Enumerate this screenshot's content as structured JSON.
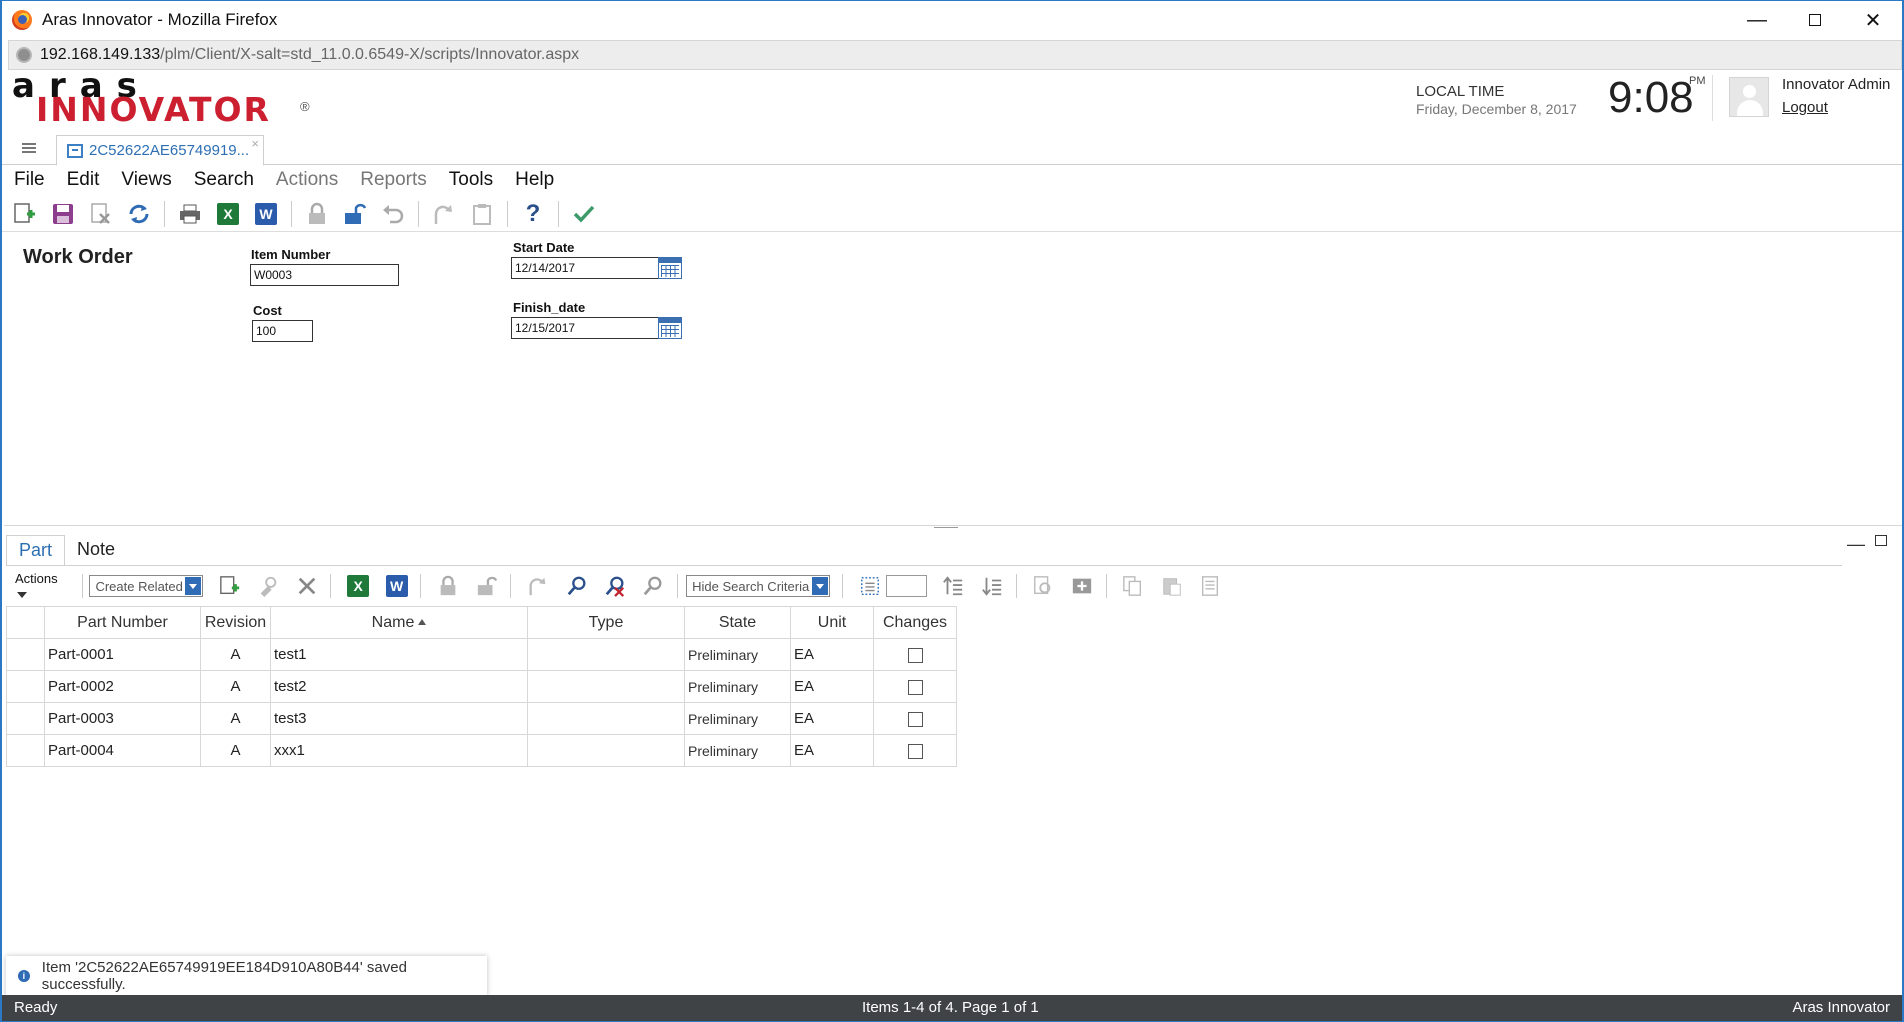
{
  "window": {
    "title": "Aras Innovator - Mozilla Firefox"
  },
  "browser": {
    "url_host": "192.168.149.133",
    "url_path": "/plm/Client/X-salt=std_11.0.0.6549-X/scripts/Innovator.aspx"
  },
  "header": {
    "logo_top": "aras",
    "logo_bottom": "INNOVATOR",
    "logo_reg": "®",
    "local_time_label": "LOCAL TIME",
    "local_date": "Friday, December 8, 2017",
    "clock": "9:08",
    "ampm": "PM",
    "user_name": "Innovator Admin",
    "logout_label": "Logout"
  },
  "doc_tab": {
    "label": "2C52622AE65749919...",
    "close": "×"
  },
  "menu": [
    "File",
    "Edit",
    "Views",
    "Search",
    "Actions",
    "Reports",
    "Tools",
    "Help"
  ],
  "form": {
    "title": "Work Order",
    "item_number_label": "Item Number",
    "item_number_value": "W0003",
    "cost_label": "Cost",
    "cost_value": "100",
    "start_date_label": "Start Date",
    "start_date_value": "12/14/2017",
    "finish_date_label": "Finish_date",
    "finish_date_value": "12/15/2017"
  },
  "relationship_tabs": [
    "Part",
    "Note"
  ],
  "rel_toolbar": {
    "actions_label": "Actions",
    "create_related": "Create Related",
    "hide_search": "Hide Search Criteria"
  },
  "grid": {
    "columns": [
      "Part Number",
      "Revision",
      "Name",
      "Type",
      "State",
      "Unit",
      "Changes"
    ],
    "rows": [
      {
        "part_number": "Part-0001",
        "revision": "A",
        "name": "test1",
        "type": "",
        "state": "Preliminary",
        "unit": "EA"
      },
      {
        "part_number": "Part-0002",
        "revision": "A",
        "name": "test2",
        "type": "",
        "state": "Preliminary",
        "unit": "EA"
      },
      {
        "part_number": "Part-0003",
        "revision": "A",
        "name": "test3",
        "type": "",
        "state": "Preliminary",
        "unit": "EA"
      },
      {
        "part_number": "Part-0004",
        "revision": "A",
        "name": "xxx1",
        "type": "",
        "state": "Preliminary",
        "unit": "EA"
      }
    ]
  },
  "notification": {
    "message": "Item '2C52622AE65749919EE184D910A80B44' saved successfully."
  },
  "status": {
    "left": "Ready",
    "middle": "Items 1-4 of 4. Page 1 of 1",
    "right": "Aras Innovator"
  },
  "colors": {
    "accent_blue": "#2d6fb3",
    "brand_red": "#cc1f2f",
    "status_bar": "#3f4346",
    "excel_green": "#1f7a3a",
    "word_blue": "#2b5bab"
  }
}
